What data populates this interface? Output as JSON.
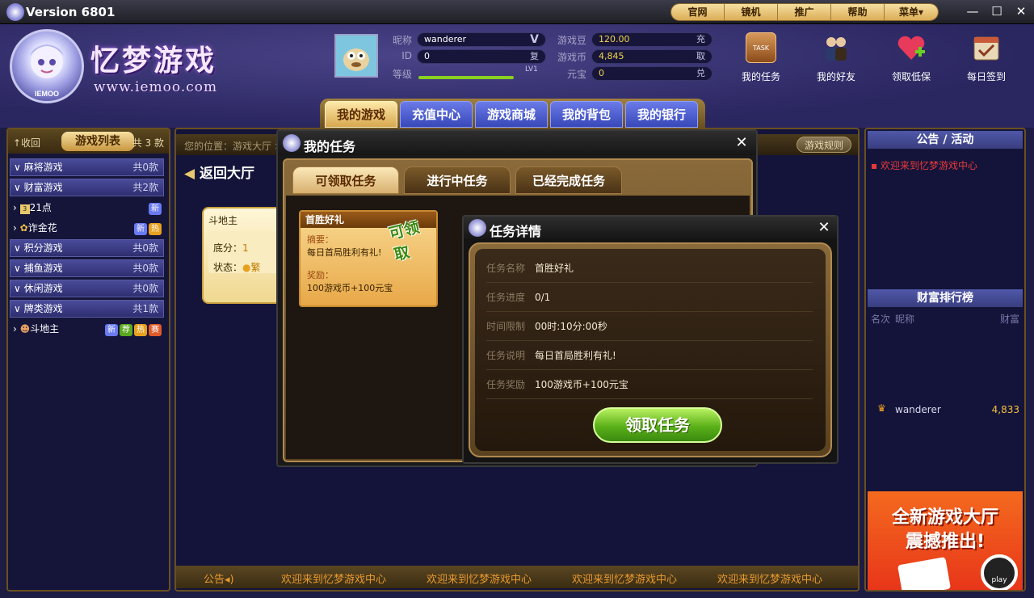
{
  "titlebar": {
    "version": "Version 6801"
  },
  "topnav": [
    "官网",
    "镜机",
    "推广",
    "帮助",
    "菜单▾"
  ],
  "brand": {
    "name": "忆梦游戏",
    "site": "www.iemoo.com"
  },
  "user": {
    "nick_label": "昵称",
    "nick": "wanderer",
    "nick_badge": "V",
    "id_label": "ID",
    "id": "0",
    "id_btn": "复",
    "level_label": "等级",
    "level_text": "LV1",
    "bean_label": "游戏豆",
    "bean": "120.00",
    "bean_btn": "充",
    "coin_label": "游戏币",
    "coin": "4,845",
    "coin_btn": "取",
    "yuanbao_label": "元宝",
    "yuanbao": "0",
    "yuanbao_btn": "兑"
  },
  "tools": [
    "我的任务",
    "我的好友",
    "领取低保",
    "每日签到"
  ],
  "tools_icon_text": "TASK",
  "maintabs": [
    "我的游戏",
    "充值中心",
    "游戏商城",
    "我的背包",
    "我的银行"
  ],
  "left": {
    "collapse": "↑收回",
    "title": "游戏列表",
    "count": "共 3 款",
    "cats": [
      {
        "label": "麻将游戏",
        "count": "共0款"
      },
      {
        "label": "财富游戏",
        "count": "共2款"
      },
      {
        "label": "积分游戏",
        "count": "共0款"
      },
      {
        "label": "捕鱼游戏",
        "count": "共0款"
      },
      {
        "label": "休闲游戏",
        "count": "共0款"
      },
      {
        "label": "牌类游戏",
        "count": "共1款"
      }
    ],
    "games": [
      {
        "label": "21点"
      },
      {
        "label": "诈金花"
      },
      {
        "label": "斗地主"
      }
    ],
    "badges": {
      "new": "新",
      "hot": "热",
      "rec": "荐",
      "sai": "赛"
    }
  },
  "center": {
    "path": "您的位置：游戏大厅 >",
    "rules": "游戏规则",
    "back": "返回大厅",
    "card": {
      "title": "斗地主",
      "base_label": "底分：",
      "base": "1",
      "status_label": "状态：",
      "status": "繁"
    },
    "announce_label": "公告",
    "announce": [
      "欢迎来到忆梦游戏中心",
      "欢迎来到忆梦游戏中心",
      "欢迎来到忆梦游戏中心",
      "欢迎来到忆梦游戏中心"
    ]
  },
  "right": {
    "notice_title": "公告 / 活动",
    "notice": "欢迎来到忆梦游戏中心",
    "rank_title": "财富排行榜",
    "rank_cols": [
      "名次",
      "昵称",
      "财富"
    ],
    "rank": [
      {
        "nick": "wanderer",
        "wealth": "4,833"
      }
    ],
    "ad_l1": "全新游戏大厅",
    "ad_l2": "震撼推出!",
    "ad_play": "play"
  },
  "taskwin": {
    "title": "我的任务",
    "tabs": [
      "可领取任务",
      "进行中任务",
      "已经完成任务"
    ],
    "card": {
      "title": "首胜好礼",
      "stamp": "可领取",
      "summary_label": "摘要：",
      "summary": "每日首局胜利有礼!",
      "reward_label": "奖励：",
      "reward": "100游戏币+100元宝"
    }
  },
  "detailwin": {
    "title": "任务详情",
    "rows": [
      {
        "k": "任务名称",
        "v": "首胜好礼"
      },
      {
        "k": "任务进度",
        "v": "0/1"
      },
      {
        "k": "时间限制",
        "v": "00时:10分:00秒"
      },
      {
        "k": "任务说明",
        "v": "每日首局胜利有礼!"
      },
      {
        "k": "任务奖励",
        "v": "100游戏币+100元宝"
      }
    ],
    "button": "领取任务"
  }
}
